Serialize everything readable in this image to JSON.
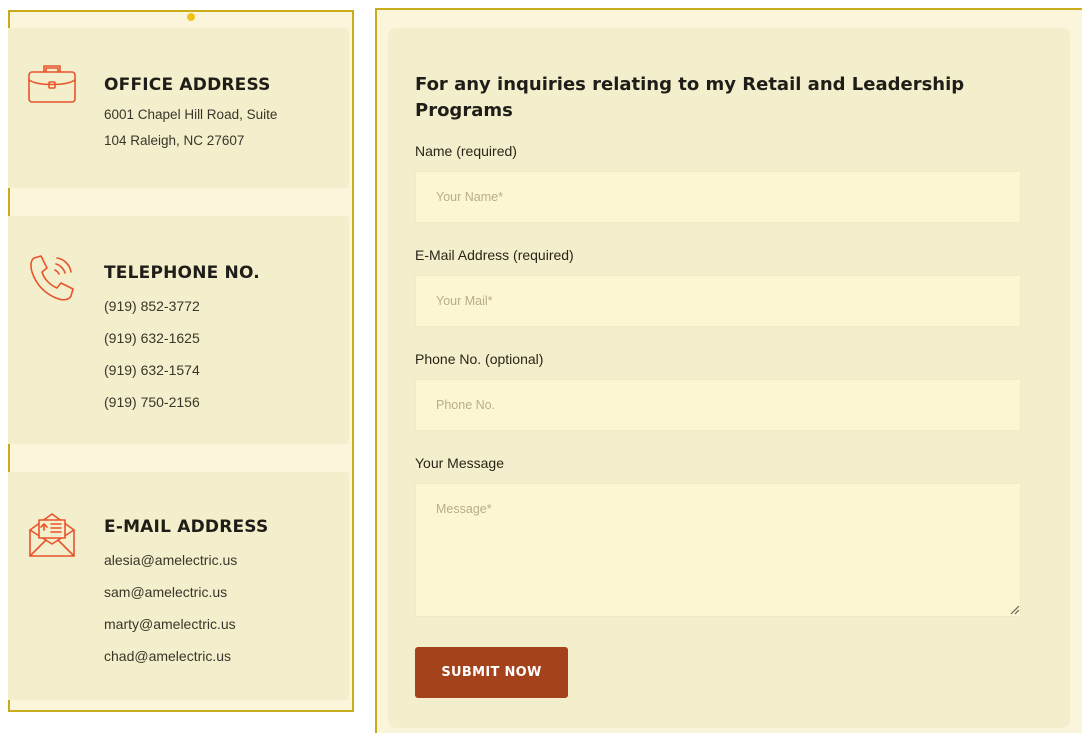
{
  "contact": {
    "office": {
      "title": "OFFICE ADDRESS",
      "lines": [
        "6001 Chapel Hill Road, Suite",
        "104 Raleigh, NC 27607"
      ],
      "icon": "briefcase-icon"
    },
    "telephone": {
      "title": "TELEPHONE NO.",
      "lines": [
        "(919) 852-3772",
        "(919) 632-1625",
        "(919) 632-1574",
        "(919) 750-2156"
      ],
      "icon": "phone-icon"
    },
    "email": {
      "title": "E-MAIL ADDRESS",
      "lines": [
        "alesia@amelectric.us",
        "sam@amelectric.us",
        "marty@amelectric.us",
        "chad@amelectric.us"
      ],
      "icon": "envelope-icon"
    }
  },
  "form": {
    "heading": "For any inquiries relating to my Retail and Leadership Programs",
    "name_label": "Name (required)",
    "name_placeholder": "Your Name*",
    "email_label": "E-Mail Address (required)",
    "email_placeholder": "Your Mail*",
    "phone_label": "Phone No. (optional)",
    "phone_placeholder": "Phone No.",
    "message_label": "Your Message",
    "message_placeholder": "Message*",
    "submit_label": "SUBMIT NOW"
  },
  "colors": {
    "accent_icon": "#e8542d",
    "button": "#a4421c",
    "outline": "#c9ac1c",
    "card_bg": "#f3efcc",
    "field_bg": "#fcf7d2"
  }
}
